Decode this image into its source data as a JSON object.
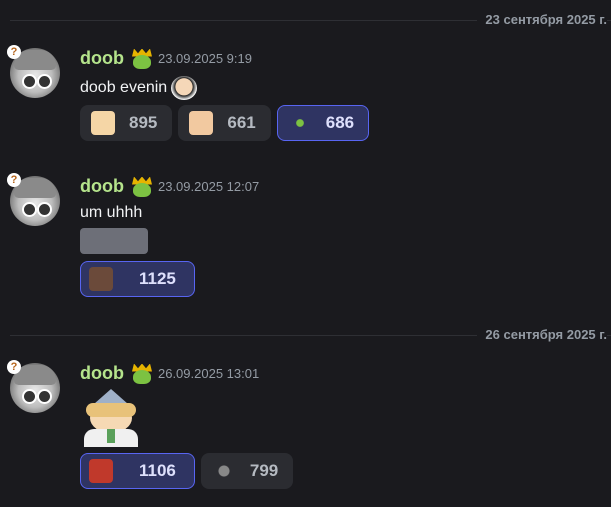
{
  "dividers": [
    {
      "label": "23 сентября 2025 г."
    },
    {
      "label": "26 сентября 2025 г."
    }
  ],
  "messages": [
    {
      "username": "doob",
      "timestamp": "23.09.2025 9:19",
      "text": "doob evenin",
      "reactions": [
        {
          "emoji": "shiba-dog-emoji",
          "count": "895",
          "active": false
        },
        {
          "emoji": "anime-face-emoji",
          "count": "661",
          "active": false
        },
        {
          "emoji": "small-creature-emoji",
          "count": "686",
          "active": true
        }
      ]
    },
    {
      "username": "doob",
      "timestamp": "23.09.2025 12:07",
      "text": "um uhhh",
      "reactions": [
        {
          "emoji": "photo-emoji",
          "count": "1125",
          "active": true
        }
      ]
    },
    {
      "username": "doob",
      "timestamp": "26.09.2025 13:01",
      "text": "",
      "reactions": [
        {
          "emoji": "red-character-emoji",
          "count": "1106",
          "active": true
        },
        {
          "emoji": "cat-emoji",
          "count": "799",
          "active": false
        }
      ]
    }
  ],
  "colors": {
    "background": "#1a1a1e",
    "username": "#b5e48c",
    "active_reaction_bg": "#2f3462",
    "active_reaction_border": "#5865f2",
    "reaction_bg": "#2b2c31"
  }
}
